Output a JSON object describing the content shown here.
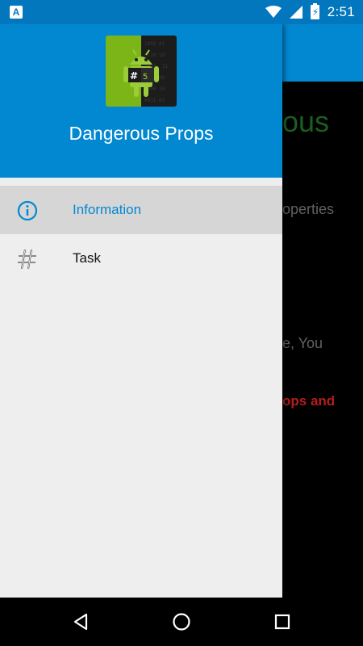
{
  "status_bar": {
    "time": "2:51",
    "left_icon": "A",
    "icons": [
      "wifi-icon",
      "signal-icon",
      "battery-charging-icon"
    ]
  },
  "background": {
    "title_fragment": "ous",
    "line1_fragment": "operties",
    "line2_fragment": "e, You",
    "line3_fragment": "ops and"
  },
  "drawer": {
    "app_name": "Dangerous Props",
    "logo_text": "#5",
    "items": [
      {
        "label": "Information",
        "icon": "info-icon",
        "active": true
      },
      {
        "label": "Task",
        "icon": "hash-icon",
        "active": false
      }
    ]
  },
  "nav_bar": {
    "buttons": [
      "back-icon",
      "home-icon",
      "recents-icon"
    ]
  },
  "colors": {
    "primary": "#0288d1",
    "primary_dark": "#0277bd",
    "active_text": "#0288d1",
    "drawer_bg": "#eeeeee",
    "active_bg": "#d6d6d6"
  }
}
